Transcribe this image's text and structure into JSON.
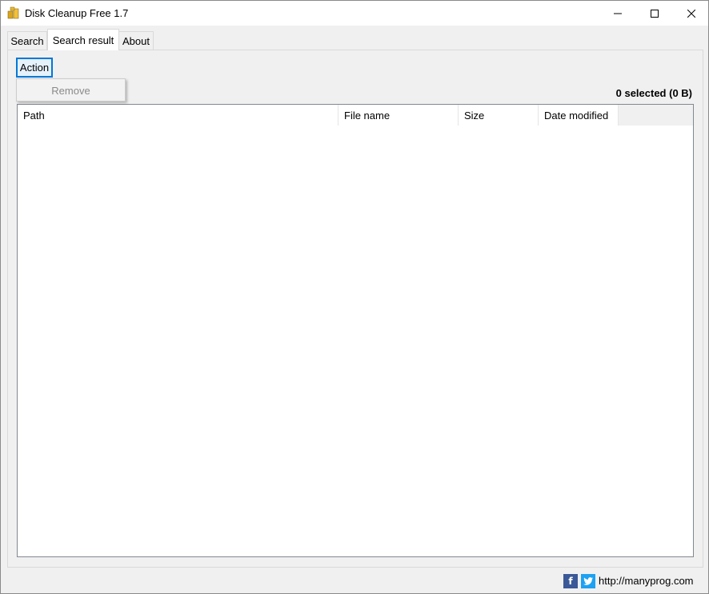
{
  "window": {
    "title": "Disk Cleanup Free 1.7"
  },
  "tabs": [
    {
      "label": "Search"
    },
    {
      "label": "Search result",
      "active": true
    },
    {
      "label": "About"
    }
  ],
  "toolbar": {
    "action_label": "Action",
    "menu": [
      {
        "label": "Remove",
        "enabled": false
      }
    ]
  },
  "status": {
    "selected_text": "0 selected (0 B)"
  },
  "table": {
    "columns": [
      "Path",
      "File name",
      "Size",
      "Date modified"
    ],
    "rows": []
  },
  "footer": {
    "link_text": "http://manyprog.com",
    "icons": [
      "facebook-icon",
      "twitter-icon"
    ]
  },
  "colors": {
    "accent": "#0078d7",
    "facebook": "#3b5998",
    "twitter": "#1da1f2"
  }
}
